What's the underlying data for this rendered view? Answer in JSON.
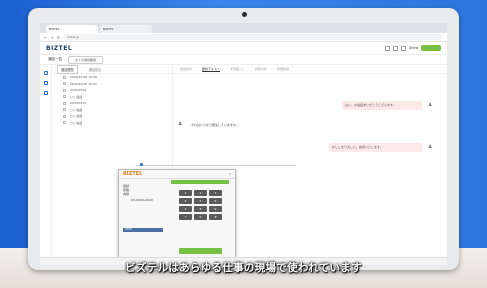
{
  "browser": {
    "tabs": [
      "BIZTEL",
      "BIZTEL"
    ],
    "url": "biztel.jp"
  },
  "app": {
    "logo": "BIZTEL",
    "header_button": "",
    "user_name": "Shiro"
  },
  "subheader": {
    "label": "通話一覧",
    "tab": "全ての通話履歴"
  },
  "left_panel": {
    "tabs": [
      "通話履歴",
      "通話統計"
    ],
    "rows": [
      "2024/10/30 10:30",
      "2024/10/30 10:32",
      "XXXXXXXX",
      "○○ 電話",
      "XXXXXXXX",
      "○○ 電話",
      "○○ 電話",
      "○○ 電話"
    ]
  },
  "main": {
    "tabs": [
      "会話全文",
      "要約テキスト",
      "文字起こし",
      "感情分析",
      "評価情報"
    ],
    "bubbles": [
      "はい、お電話ありがとうございます。",
      "それはいつから発生していますか。",
      "かしこまりました。確認いたします。"
    ]
  },
  "softphone": {
    "logo": "BIZTEL",
    "close": "×",
    "status_bar": "",
    "info_lines": [
      "通話",
      "受信",
      "内線"
    ],
    "number": "03-XXXX-XXXX",
    "bar_text": "XXXX",
    "keys": [
      "1",
      "2",
      "3",
      "4",
      "5",
      "6",
      "7",
      "8",
      "9",
      "*",
      "0",
      "#"
    ]
  },
  "records": [
    "○○ 電話",
    "○○ 電話"
  ],
  "caption": "ビズテルはあらゆる仕事の現場で使われています",
  "colors": {
    "accent": "#76c043",
    "brand": "#1f3b63",
    "phone_logo": "#e07b1a"
  }
}
